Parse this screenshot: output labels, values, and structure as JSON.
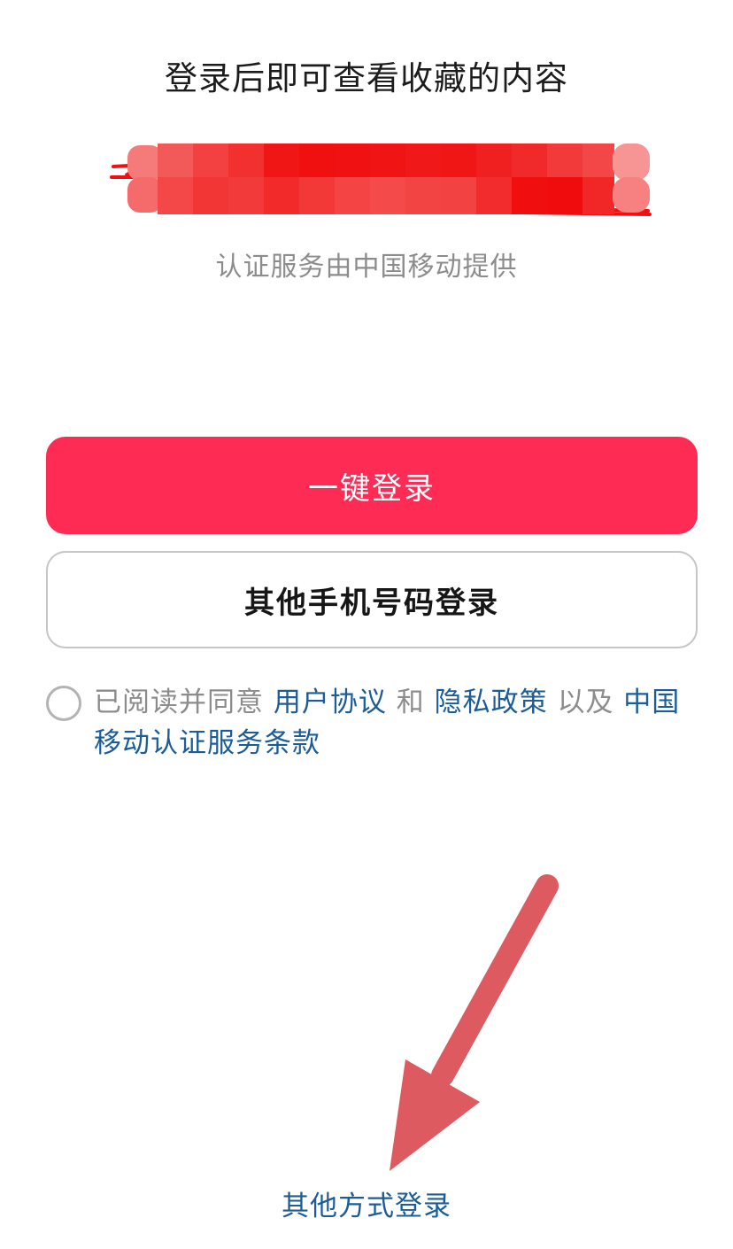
{
  "header": {
    "title": "登录后即可查看收藏的内容"
  },
  "phone": {
    "provider_note": "认证服务由中国移动提供"
  },
  "actions": {
    "one_click_label": "一键登录",
    "other_phone_label": "其他手机号码登录"
  },
  "agreement": {
    "prefix": "已阅读并同意",
    "user_agreement": "用户协议",
    "and": "和",
    "privacy_policy": "隐私政策",
    "and_also": "以及",
    "cmcc_terms": "中国移动认证服务条款",
    "checked": false
  },
  "footer": {
    "other_methods_label": "其他方式登录"
  },
  "colors": {
    "primary": "#fe2c55",
    "link": "#1c5d99",
    "mask": "#f01010",
    "annotation_arrow": "#dc5a60"
  },
  "icons": {
    "checkbox": "circle-checkbox-icon",
    "annotation": "arrow-annotation-icon"
  }
}
